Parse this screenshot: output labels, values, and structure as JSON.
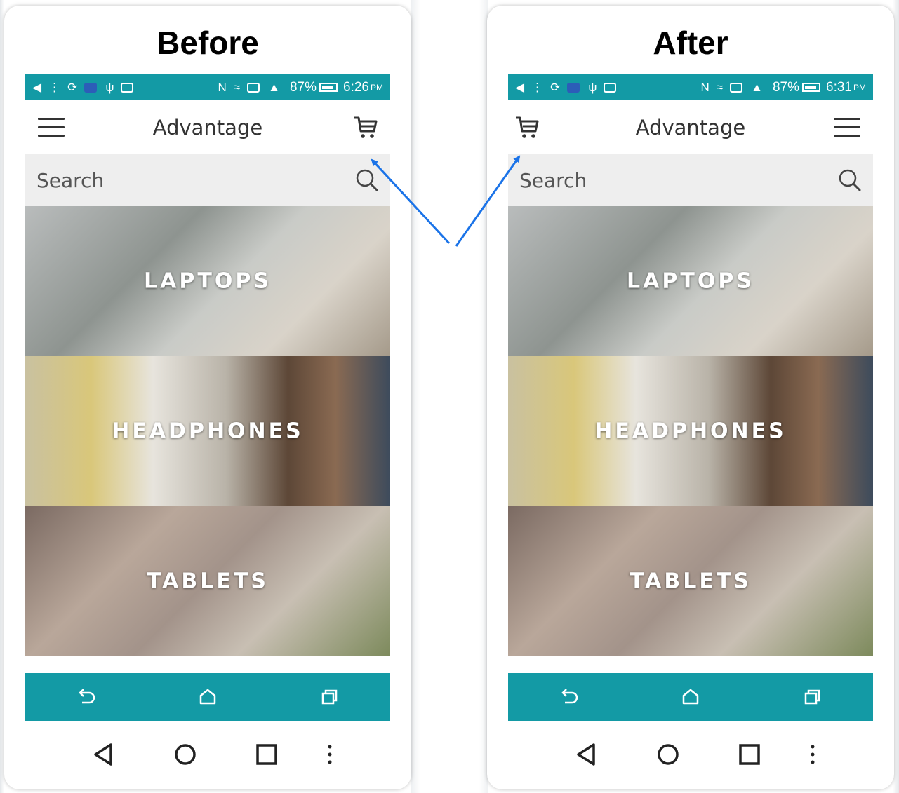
{
  "panels": {
    "before": {
      "title": "Before",
      "status_bar": {
        "battery_percent": "87%",
        "time": "6:26",
        "time_suffix": "PM"
      },
      "app_bar": {
        "title": "Advantage",
        "menu_icon": "hamburger-icon",
        "cart_icon": "cart-icon",
        "cart_position": "right"
      },
      "search": {
        "placeholder": "Search",
        "icon": "search-icon"
      },
      "categories": [
        {
          "label": "LAPTOPS"
        },
        {
          "label": "HEADPHONES"
        },
        {
          "label": "TABLETS"
        }
      ]
    },
    "after": {
      "title": "After",
      "status_bar": {
        "battery_percent": "87%",
        "time": "6:31",
        "time_suffix": "PM"
      },
      "app_bar": {
        "title": "Advantage",
        "menu_icon": "hamburger-icon",
        "cart_icon": "cart-icon",
        "cart_position": "left"
      },
      "search": {
        "placeholder": "Search",
        "icon": "search-icon"
      },
      "categories": [
        {
          "label": "LAPTOPS"
        },
        {
          "label": "HEADPHONES"
        },
        {
          "label": "TABLETS"
        }
      ]
    }
  },
  "app_nav_icons": [
    "back-icon",
    "home-icon",
    "recents-icon"
  ],
  "phone_nav_icons": [
    "back-triangle-icon",
    "home-circle-icon",
    "recents-square-icon",
    "more-dots-icon"
  ],
  "colors": {
    "accent": "#139aa5",
    "arrow": "#1a73e8",
    "search_bg": "#eeeeee"
  }
}
